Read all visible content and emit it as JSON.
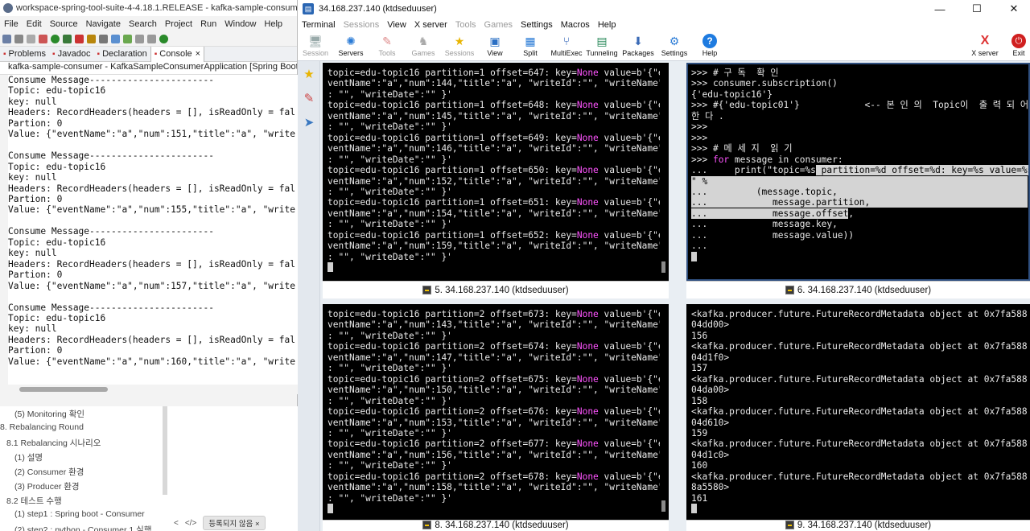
{
  "eclipse": {
    "title": "workspace-spring-tool-suite-4-4.18.1.RELEASE - kafka-sample-consumer/src/m",
    "menu": [
      "File",
      "Edit",
      "Source",
      "Navigate",
      "Search",
      "Project",
      "Run",
      "Window",
      "Help"
    ],
    "tabs": [
      {
        "label": "Problems",
        "active": false
      },
      {
        "label": "Javadoc",
        "active": false
      },
      {
        "label": "Declaration",
        "active": false
      },
      {
        "label": "Console",
        "active": true
      }
    ],
    "console_close": "×",
    "console_path": "kafka-sample-consumer - KafkaSampleConsumerApplication [Spring Boot Ap",
    "console_text": "Consume Message-----------------------\nTopic: edu-topic16\nkey: null\nHeaders: RecordHeaders(headers = [], isReadOnly = fal\nPartion: 0\nValue: {\"eventName\":\"a\",\"num\":151,\"title\":\"a\", \"write\n\nConsume Message-----------------------\nTopic: edu-topic16\nkey: null\nHeaders: RecordHeaders(headers = [], isReadOnly = fal\nPartion: 0\nValue: {\"eventName\":\"a\",\"num\":155,\"title\":\"a\", \"write\n\nConsume Message-----------------------\nTopic: edu-topic16\nkey: null\nHeaders: RecordHeaders(headers = [], isReadOnly = fal\nPartion: 0\nValue: {\"eventName\":\"a\",\"num\":157,\"title\":\"a\", \"write\n\nConsume Message-----------------------\nTopic: edu-topic16\nkey: null\nHeaders: RecordHeaders(headers = [], isReadOnly = fal\nPartion: 0\nValue: {\"eventName\":\"a\",\"num\":160,\"title\":\"a\", \"write"
  },
  "outline": {
    "items": [
      "(5) Monitoring 확인",
      "8. Rebalancing Round",
      "8.1 Rebalancing 시나리오",
      "(1) 설명",
      "(2) Consumer 환경",
      "(3) Producer 환경",
      "8.2 테스트 수행",
      "(1) step1 : Spring boot - Consumer",
      "(2) step2 : python - Consumer 1 실행"
    ],
    "nav_prev": "<",
    "nav_code": "</>",
    "tag_button": "등록되지 않음 ×"
  },
  "moba": {
    "title": "34.168.237.140 (ktdseduuser)",
    "menu": [
      {
        "label": "Terminal",
        "enabled": true
      },
      {
        "label": "Sessions",
        "enabled": false
      },
      {
        "label": "View",
        "enabled": true
      },
      {
        "label": "X server",
        "enabled": true
      },
      {
        "label": "Tools",
        "enabled": false
      },
      {
        "label": "Games",
        "enabled": false
      },
      {
        "label": "Settings",
        "enabled": true
      },
      {
        "label": "Macros",
        "enabled": true
      },
      {
        "label": "Help",
        "enabled": true
      }
    ],
    "toolbar": [
      {
        "label": "Session",
        "enabled": false,
        "icon": "monitor-icon"
      },
      {
        "label": "Servers",
        "enabled": true,
        "icon": "servers-icon"
      },
      {
        "label": "Tools",
        "enabled": false,
        "icon": "tools-icon"
      },
      {
        "label": "Games",
        "enabled": false,
        "icon": "games-icon"
      },
      {
        "label": "Sessions",
        "enabled": false,
        "icon": "star-icon"
      },
      {
        "label": "View",
        "enabled": true,
        "icon": "view-icon"
      },
      {
        "label": "Split",
        "enabled": true,
        "icon": "split-icon"
      },
      {
        "label": "MultiExec",
        "enabled": true,
        "icon": "multiexec-icon"
      },
      {
        "label": "Tunneling",
        "enabled": true,
        "icon": "tunneling-icon"
      },
      {
        "label": "Packages",
        "enabled": true,
        "icon": "packages-icon"
      },
      {
        "label": "Settings",
        "enabled": true,
        "icon": "gear-icon"
      },
      {
        "label": "Help",
        "enabled": true,
        "icon": "help-icon"
      },
      {
        "label": "X server",
        "enabled": true,
        "icon": "x-server-icon"
      },
      {
        "label": "Exit",
        "enabled": true,
        "icon": "power-icon"
      }
    ],
    "window_controls": {
      "minimize": "—",
      "maximize": "☐",
      "close": "✕"
    }
  },
  "panes": {
    "p5": {
      "label": "5. 34.168.237.140 (ktdseduuser)",
      "lines": [
        [
          "topic=edu-topic16 partition=1 offset=647: key=",
          "None",
          " value=b'{\"e"
        ],
        [
          "ventName\":\"a\",\"num\":144,\"title\":\"a\", \"writeId\":\"\", \"writeName\""
        ],
        [
          ": \"\", \"writeDate\":\"\" }'"
        ],
        [
          "topic=edu-topic16 partition=1 offset=648: key=",
          "None",
          " value=b'{\"e"
        ],
        [
          "ventName\":\"a\",\"num\":145,\"title\":\"a\", \"writeId\":\"\", \"writeName\""
        ],
        [
          ": \"\", \"writeDate\":\"\" }'"
        ],
        [
          "topic=edu-topic16 partition=1 offset=649: key=",
          "None",
          " value=b'{\"e"
        ],
        [
          "ventName\":\"a\",\"num\":146,\"title\":\"a\", \"writeId\":\"\", \"writeName\""
        ],
        [
          ": \"\", \"writeDate\":\"\" }'"
        ],
        [
          "topic=edu-topic16 partition=1 offset=650: key=",
          "None",
          " value=b'{\"e"
        ],
        [
          "ventName\":\"a\",\"num\":152,\"title\":\"a\", \"writeId\":\"\", \"writeName\""
        ],
        [
          ": \"\", \"writeDate\":\"\" }'"
        ],
        [
          "topic=edu-topic16 partition=1 offset=651: key=",
          "None",
          " value=b'{\"e"
        ],
        [
          "ventName\":\"a\",\"num\":154,\"title\":\"a\", \"writeId\":\"\", \"writeName\""
        ],
        [
          ": \"\", \"writeDate\":\"\" }'"
        ],
        [
          "topic=edu-topic16 partition=1 offset=652: key=",
          "None",
          " value=b'{\"e"
        ],
        [
          "ventName\":\"a\",\"num\":159,\"title\":\"a\", \"writeId\":\"\", \"writeName\""
        ],
        [
          ": \"\", \"writeDate\":\"\" }'"
        ]
      ]
    },
    "p6": {
      "label": "6. 34.168.237.140 (ktdseduuser)",
      "lines": [
        ">>> # 구 독  확 인",
        ">>> consumer.subscription()",
        "{'edu-topic16'}",
        ">>> #{'edu-topic01'}            <-- 본 인 의  Topic이  출 력 되 어 야",
        "한 다 .",
        ">>>",
        ">>>",
        ">>> # 메 세 지  읽 기",
        ">>> for message in consumer:",
        "...     print(\"topic=%s partition=%d offset=%d: key=%s value=%s",
        "\" %",
        "...         (message.topic,",
        "...            message.partition,",
        "...            message.offset,",
        "...            message.key,",
        "...            message.value))",
        "..."
      ]
    },
    "p8": {
      "label": "8. 34.168.237.140 (ktdseduuser)",
      "lines": [
        [
          "topic=edu-topic16 partition=2 offset=673: key=",
          "None",
          " value=b'{\"e"
        ],
        [
          "ventName\":\"a\",\"num\":143,\"title\":\"a\", \"writeId\":\"\", \"writeName\""
        ],
        [
          ": \"\", \"writeDate\":\"\" }'"
        ],
        [
          "topic=edu-topic16 partition=2 offset=674: key=",
          "None",
          " value=b'{\"e"
        ],
        [
          "ventName\":\"a\",\"num\":147,\"title\":\"a\", \"writeId\":\"\", \"writeName\""
        ],
        [
          ": \"\", \"writeDate\":\"\" }'"
        ],
        [
          "topic=edu-topic16 partition=2 offset=675: key=",
          "None",
          " value=b'{\"e"
        ],
        [
          "ventName\":\"a\",\"num\":150,\"title\":\"a\", \"writeId\":\"\", \"writeName\""
        ],
        [
          ": \"\", \"writeDate\":\"\" }'"
        ],
        [
          "topic=edu-topic16 partition=2 offset=676: key=",
          "None",
          " value=b'{\"e"
        ],
        [
          "ventName\":\"a\",\"num\":153,\"title\":\"a\", \"writeId\":\"\", \"writeName\""
        ],
        [
          ": \"\", \"writeDate\":\"\" }'"
        ],
        [
          "topic=edu-topic16 partition=2 offset=677: key=",
          "None",
          " value=b'{\"e"
        ],
        [
          "ventName\":\"a\",\"num\":156,\"title\":\"a\", \"writeId\":\"\", \"writeName\""
        ],
        [
          ": \"\", \"writeDate\":\"\" }'"
        ],
        [
          "topic=edu-topic16 partition=2 offset=678: key=",
          "None",
          " value=b'{\"e"
        ],
        [
          "ventName\":\"a\",\"num\":158,\"title\":\"a\", \"writeId\":\"\", \"writeName\""
        ],
        [
          ": \"\", \"writeDate\":\"\" }'"
        ]
      ]
    },
    "p9": {
      "label": "9. 34.168.237.140 (ktdseduuser)",
      "lines": [
        "<kafka.producer.future.FutureRecordMetadata object at 0x7fa588",
        "04dd00>",
        "156",
        "<kafka.producer.future.FutureRecordMetadata object at 0x7fa588",
        "04d1f0>",
        "157",
        "<kafka.producer.future.FutureRecordMetadata object at 0x7fa588",
        "04da00>",
        "158",
        "<kafka.producer.future.FutureRecordMetadata object at 0x7fa588",
        "04d610>",
        "159",
        "<kafka.producer.future.FutureRecordMetadata object at 0x7fa588",
        "04d1c0>",
        "160",
        "<kafka.producer.future.FutureRecordMetadata object at 0x7fa588",
        "8a5580>",
        "161"
      ]
    }
  },
  "colors": {
    "keyword": "#ff54ff",
    "selection": "#d4d4d4",
    "pane_focus": "#2f4f7f"
  }
}
